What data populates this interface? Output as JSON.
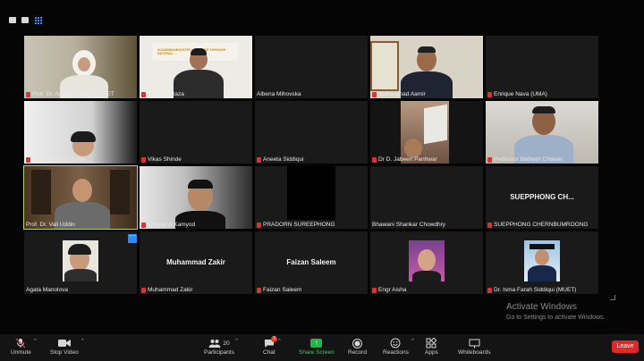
{
  "colors": {
    "accent": "#2d8cff",
    "leave": "#e02828",
    "share": "#23b34a",
    "mic_muted": "#d83434",
    "active_speaker": "#b6d458"
  },
  "gallery": {
    "tiles": [
      {
        "name": "Prof. Dr. Arabella Bhutto, MUET",
        "video": true
      },
      {
        "name": "Hasnain Raza",
        "video": true,
        "banner": "ACADEMIA/INDUSTRY ... CHANGE THROUGH NATIONAL ..."
      },
      {
        "name": "Albena Mihovska",
        "video": false
      },
      {
        "name": "Muhammad Aamir",
        "video": true
      },
      {
        "name": "Enrique Nava (UMA)",
        "video": false
      },
      {
        "name": "Punnarumol Temdee",
        "video": true
      },
      {
        "name": "Vikas Shinde",
        "video": false
      },
      {
        "name": "Aneeta Siddiqui",
        "video": false
      },
      {
        "name": "Dr D. Jabeen Panhwar",
        "video": true
      },
      {
        "name": "Professor Mahesh Chavan",
        "video": true
      },
      {
        "name": "Prof. Dr. Vali Uddin",
        "video": true,
        "active": true
      },
      {
        "name": "Chayapol Kamyod",
        "video": true
      },
      {
        "name": "PRADORN SUREEPHONG",
        "video": true
      },
      {
        "name": "Bhawani Shankar Chowdhry",
        "video": false
      },
      {
        "name": "SUEPPHONG CHERNBUMROONG",
        "video": false,
        "big_name": "SUEPPHONG CH..."
      },
      {
        "name": "Agata Manolova",
        "video": false,
        "avatar": true
      },
      {
        "name": "Muhammad Zakir",
        "video": false,
        "big_name": "Muhammad Zakir"
      },
      {
        "name": "Faizan Saleem",
        "video": false,
        "big_name": "Faizan Saleem"
      },
      {
        "name": "Engr Aisha",
        "video": false,
        "avatar": true
      },
      {
        "name": "Dr. Isma Farah Siddiqui (MUET)",
        "video": false,
        "avatar": true
      }
    ]
  },
  "watermark": {
    "line1": "Activate Windows",
    "line2": "Go to Settings to activate Windows."
  },
  "toolbar": {
    "unmute": "Unmute",
    "stop_video": "Stop Video",
    "participants": "Participants",
    "participants_count": "20",
    "chat": "Chat",
    "chat_badge": "3",
    "share_screen": "Share Screen",
    "record": "Record",
    "reactions": "Reactions",
    "apps": "Apps",
    "whiteboards": "Whiteboards",
    "leave": "Leave"
  },
  "icons": {
    "unmute": "mic-muted-icon",
    "video": "video-camera-icon",
    "participants": "people-icon",
    "chat": "chat-bubble-icon",
    "share": "share-arrow-icon",
    "record": "record-icon",
    "reactions": "smiley-icon",
    "apps": "apps-icon",
    "whiteboards": "whiteboard-icon"
  }
}
